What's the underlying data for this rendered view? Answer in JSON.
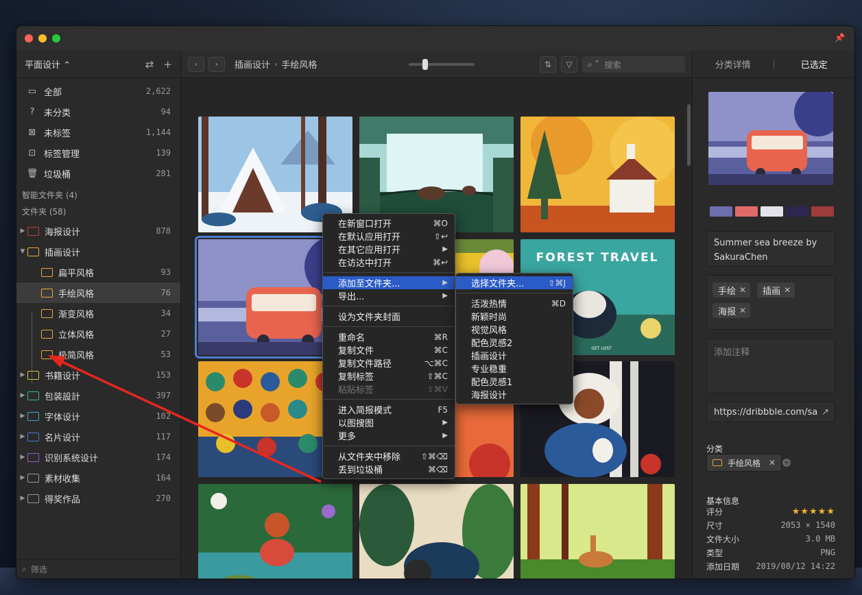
{
  "sidebar": {
    "title": "平面设计",
    "basic": [
      {
        "label": "全部",
        "count": "2,622"
      },
      {
        "label": "未分类",
        "count": "94"
      },
      {
        "label": "未标签",
        "count": "1,144"
      },
      {
        "label": "标签管理",
        "count": "139"
      },
      {
        "label": "垃圾桶",
        "count": "281"
      }
    ],
    "smart_folders": "智能文件夹 (4)",
    "folders_header": "文件夹 (58)",
    "folders": [
      {
        "label": "海报设计",
        "count": "878",
        "color": "#c83a3a"
      },
      {
        "label": "插画设计",
        "count": "",
        "color": "#e8a83a"
      },
      {
        "label": "扁平风格",
        "count": "93",
        "color": "#e8a83a"
      },
      {
        "label": "手绘风格",
        "count": "76",
        "color": "#e8a83a"
      },
      {
        "label": "渐变风格",
        "count": "34",
        "color": "#e8a83a"
      },
      {
        "label": "立体风格",
        "count": "27",
        "color": "#e8a83a"
      },
      {
        "label": "极简风格",
        "count": "53",
        "color": "#e8a83a"
      },
      {
        "label": "书籍设计",
        "count": "153",
        "color": "#d8c43a"
      },
      {
        "label": "包装設計",
        "count": "397",
        "color": "#3ab88a"
      },
      {
        "label": "字体设计",
        "count": "102",
        "color": "#3aa8c8"
      },
      {
        "label": "名片设计",
        "count": "117",
        "color": "#4a7ad0"
      },
      {
        "label": "识别系统设计",
        "count": "174",
        "color": "#9a5ad0"
      },
      {
        "label": "素材收集",
        "count": "164",
        "color": "#999999"
      },
      {
        "label": "得奖作品",
        "count": "270",
        "color": "#999999"
      }
    ],
    "filter_placeholder": "筛选"
  },
  "toolbar": {
    "crumb1": "插画设计",
    "crumb2": "手绘风格",
    "search_placeholder": "搜索"
  },
  "right": {
    "tab_detail": "分类详情",
    "tab_selected": "已选定",
    "palette": [
      "#6b6fae",
      "#e06a6a",
      "#e3e3ea",
      "#2e2550",
      "#9e3b3b"
    ],
    "title": "Summer sea breeze by SakuraChen",
    "tags": [
      "手绘",
      "插画",
      "海报"
    ],
    "note_placeholder": "添加注释",
    "url": "https://dribbble.com/sa",
    "category_label": "分类",
    "category": "手绘风格",
    "info_label": "基本信息",
    "info": {
      "rating_k": "评分",
      "rating": 5,
      "size_k": "尺寸",
      "size": "2053 × 1540",
      "filesize_k": "文件大小",
      "filesize": "3.0 MB",
      "type_k": "类型",
      "type": "PNG",
      "date_k": "添加日期",
      "date": "2019/08/12 14:22"
    }
  },
  "context_menu": [
    {
      "label": "在新窗口打开",
      "sc": "⌘O"
    },
    {
      "label": "在默认应用打开",
      "sc": "⇧↩"
    },
    {
      "label": "在其它应用打开",
      "sc": "▶"
    },
    {
      "label": "在访达中打开",
      "sc": "⌘↩"
    },
    {
      "sep": true
    },
    {
      "label": "添加至文件夹...",
      "sc": "▶",
      "hl": true
    },
    {
      "label": "导出...",
      "sc": "▶"
    },
    {
      "sep": true
    },
    {
      "label": "设为文件夹封面",
      "sc": ""
    },
    {
      "sep": true
    },
    {
      "label": "重命名",
      "sc": "⌘R"
    },
    {
      "label": "复制文件",
      "sc": "⌘C"
    },
    {
      "label": "复制文件路径",
      "sc": "⌥⌘C"
    },
    {
      "label": "复制标签",
      "sc": "⇧⌘C"
    },
    {
      "label": "粘贴标签",
      "sc": "⇧⌘V",
      "dis": true
    },
    {
      "sep": true
    },
    {
      "label": "进入简报模式",
      "sc": "F5"
    },
    {
      "label": "以图搜图",
      "sc": "▶"
    },
    {
      "label": "更多",
      "sc": "▶"
    },
    {
      "sep": true
    },
    {
      "label": "从文件夹中移除",
      "sc": "⇧⌘⌫"
    },
    {
      "label": "丢到垃圾桶",
      "sc": "⌘⌫"
    }
  ],
  "submenu": [
    {
      "label": "选择文件夹...",
      "sc": "⇧⌘J",
      "hl": true
    },
    {
      "sep": true
    },
    {
      "label": "活泼热情",
      "sc": "⌘D"
    },
    {
      "label": "新颖时尚",
      "sc": ""
    },
    {
      "label": "视觉风格",
      "sc": ""
    },
    {
      "label": "配色灵感2",
      "sc": ""
    },
    {
      "label": "插画设计",
      "sc": ""
    },
    {
      "label": "专业稳重",
      "sc": ""
    },
    {
      "label": "配色灵感1",
      "sc": ""
    },
    {
      "label": "海报设计",
      "sc": ""
    }
  ],
  "thumbs": {
    "forest_travel_title": "FOREST TRAVEL",
    "forest_travel_sub": "GET LOST"
  }
}
